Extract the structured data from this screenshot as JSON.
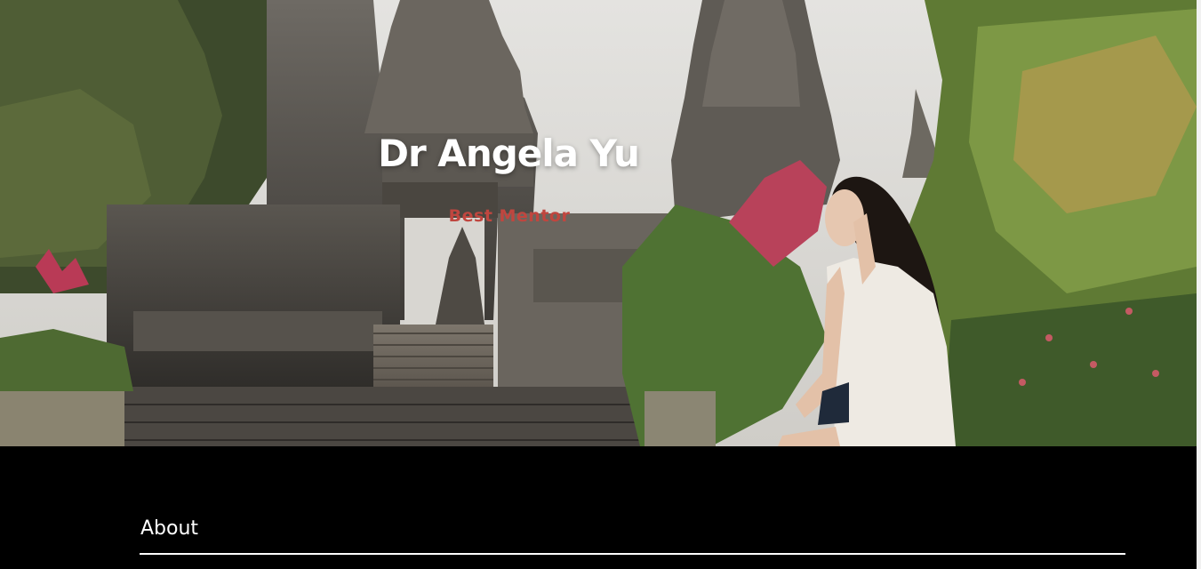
{
  "hero": {
    "title": "Dr Angela Yu",
    "subtitle": "Best Mentor",
    "background_image": "photo of a woman in a white dress seated before stone temple towers surrounded by palms and greenery"
  },
  "about": {
    "heading": "About"
  },
  "colors": {
    "page_background": "#000000",
    "title": "#ffffff",
    "subtitle_accent": "#c0463f",
    "rule": "#ffffff"
  }
}
